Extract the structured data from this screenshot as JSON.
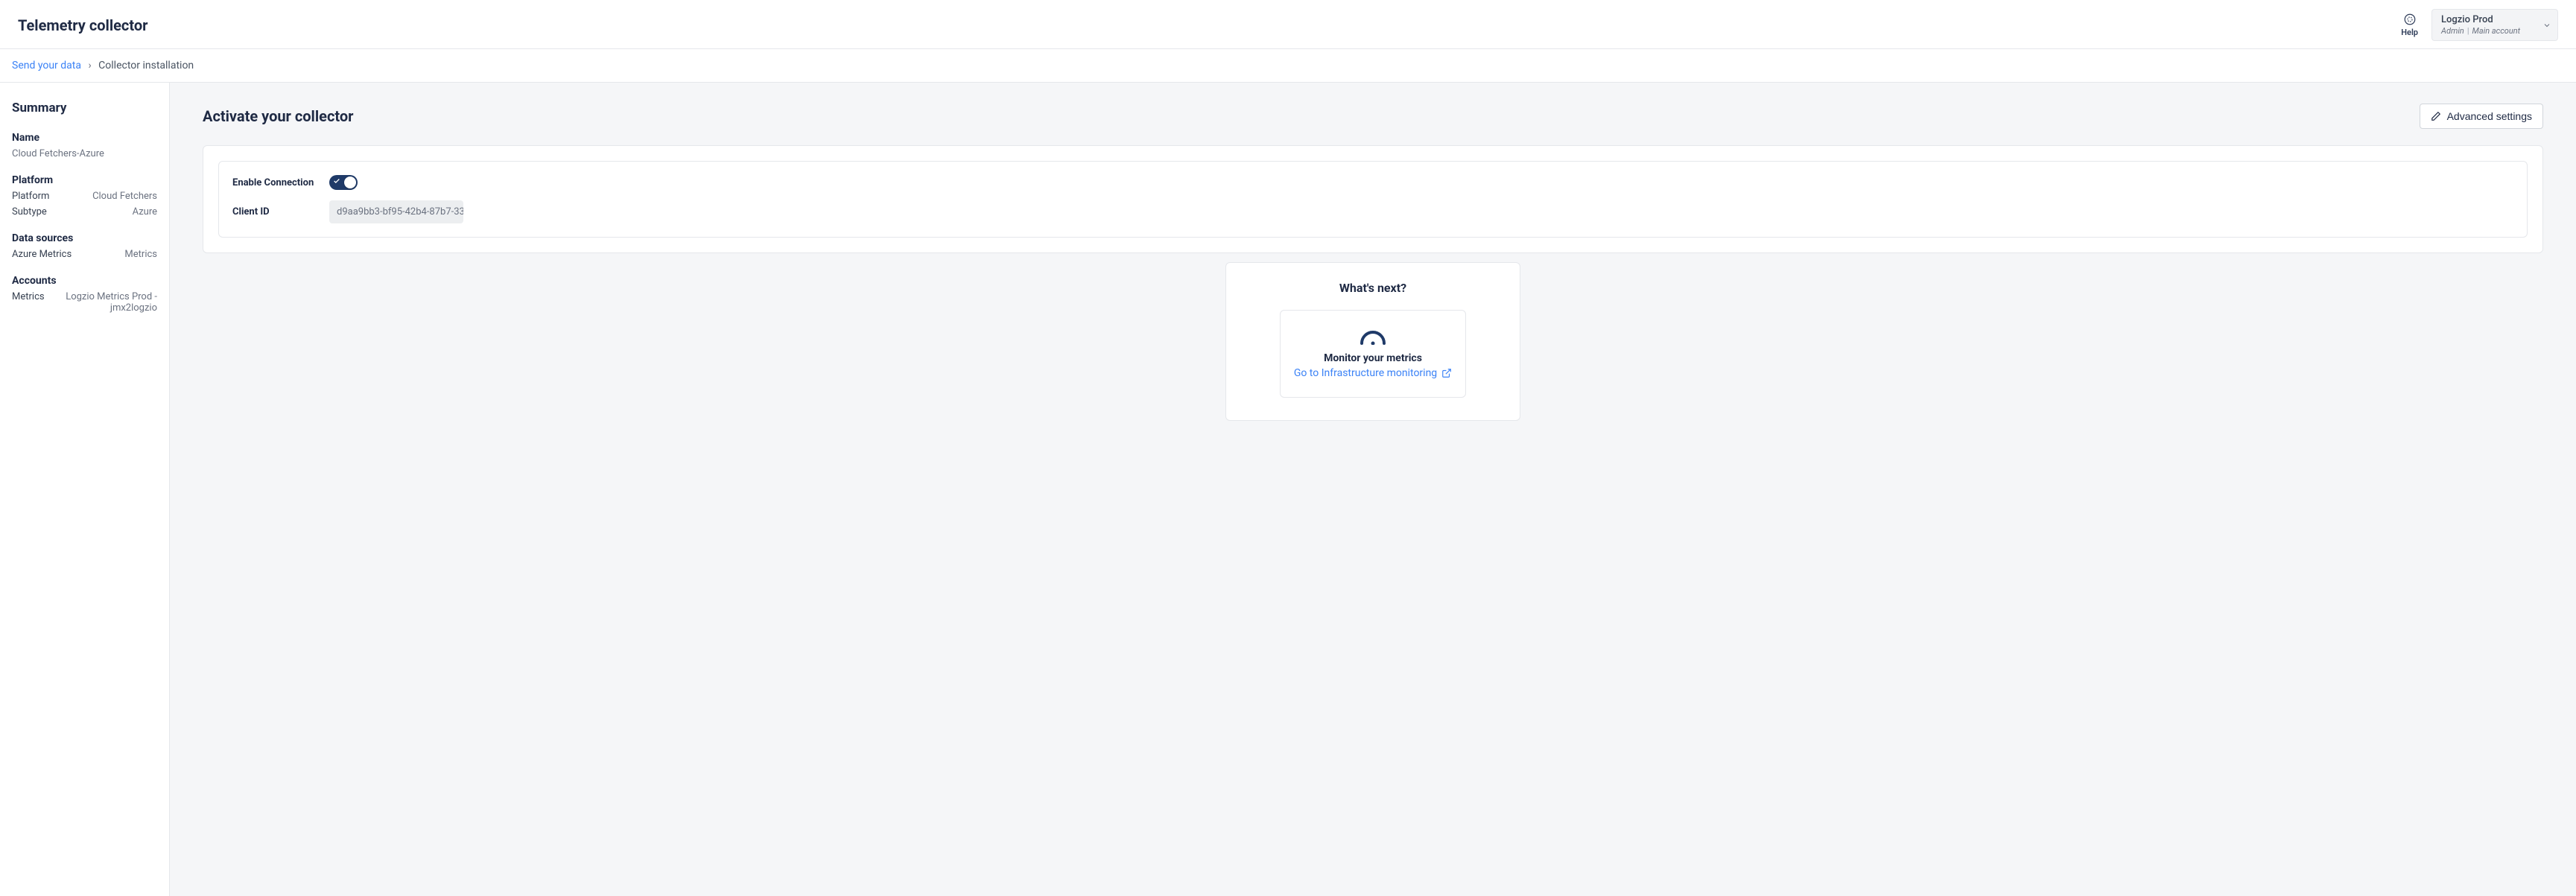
{
  "header": {
    "title": "Telemetry collector",
    "help_label": "Help",
    "account": {
      "name": "Logzio Prod",
      "role": "Admin",
      "type": "Main account"
    }
  },
  "breadcrumb": {
    "parent": "Send your data",
    "current": "Collector installation"
  },
  "sidebar": {
    "title": "Summary",
    "name_section": {
      "heading": "Name",
      "value": "Cloud Fetchers-Azure"
    },
    "platform_section": {
      "heading": "Platform",
      "rows": [
        {
          "k": "Platform",
          "v": "Cloud Fetchers"
        },
        {
          "k": "Subtype",
          "v": "Azure"
        }
      ]
    },
    "data_sources_section": {
      "heading": "Data sources",
      "rows": [
        {
          "k": "Azure Metrics",
          "v": "Metrics"
        }
      ]
    },
    "accounts_section": {
      "heading": "Accounts",
      "rows": [
        {
          "k": "Metrics",
          "v": "Logzio Metrics Prod - jmx2logzio"
        }
      ]
    }
  },
  "main": {
    "title": "Activate your collector",
    "advanced_btn": "Advanced settings",
    "enable_label": "Enable Connection",
    "client_id_label": "Client ID",
    "client_id_value": "d9aa9bb3-bf95-42b4-87b7-33",
    "next": {
      "title": "What's next?",
      "monitor_label": "Monitor your metrics",
      "link_text": "Go to Infrastructure monitoring"
    }
  }
}
